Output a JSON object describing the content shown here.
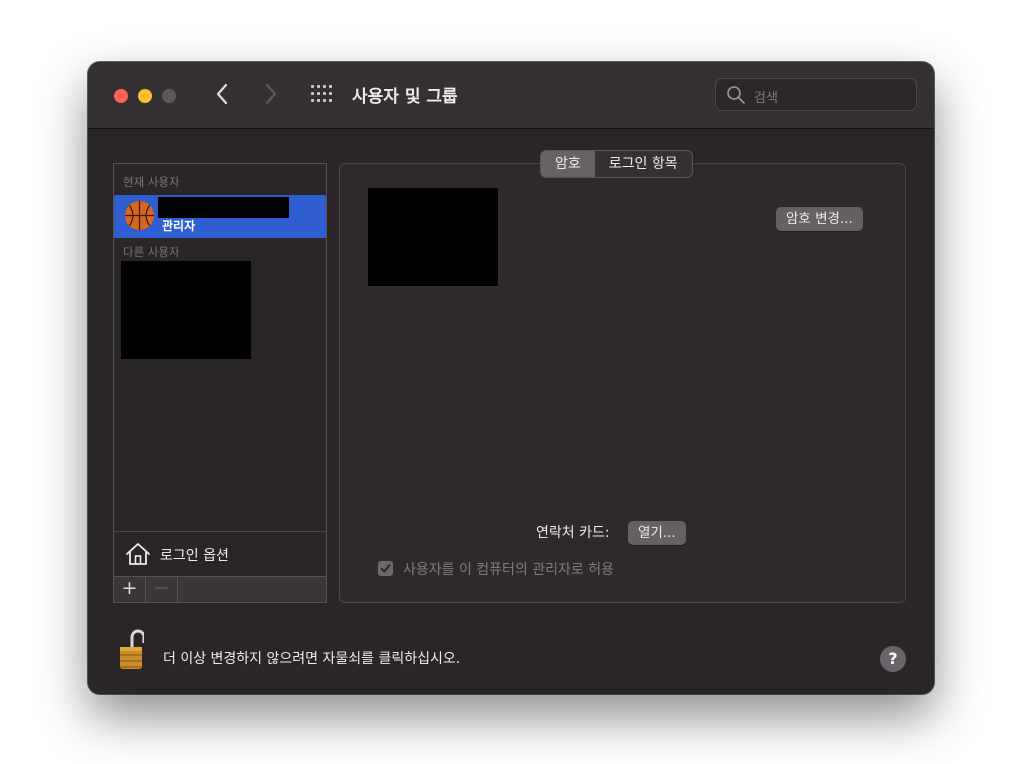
{
  "window": {
    "title": "사용자 및 그룹",
    "search_placeholder": "검색"
  },
  "sidebar": {
    "current_users_label": "현재 사용자",
    "current_user": {
      "role": "관리자",
      "avatar_icon": "basketball-icon"
    },
    "other_users_label": "다른 사용자",
    "login_options_label": "로그인 옵션",
    "add_label": "+",
    "remove_label": "—"
  },
  "tabs": [
    {
      "label": "암호",
      "active": true
    },
    {
      "label": "로그인 항목",
      "active": false
    }
  ],
  "main": {
    "change_password_label": "암호 변경...",
    "contact_card_label": "연락처 카드:",
    "open_label": "열기...",
    "allow_admin_label": "사용자를 이 컴퓨터의 관리자로 허용",
    "allow_admin_checked": true
  },
  "footer": {
    "lock_text": "더 이상 변경하지 않으려면 자물쇠를 클릭하십시오.",
    "help_label": "?"
  },
  "colors": {
    "selection": "#2f5ed1",
    "close": "#fe5f57",
    "minimize": "#febc2e",
    "zoom_disabled": "#5c5859"
  }
}
